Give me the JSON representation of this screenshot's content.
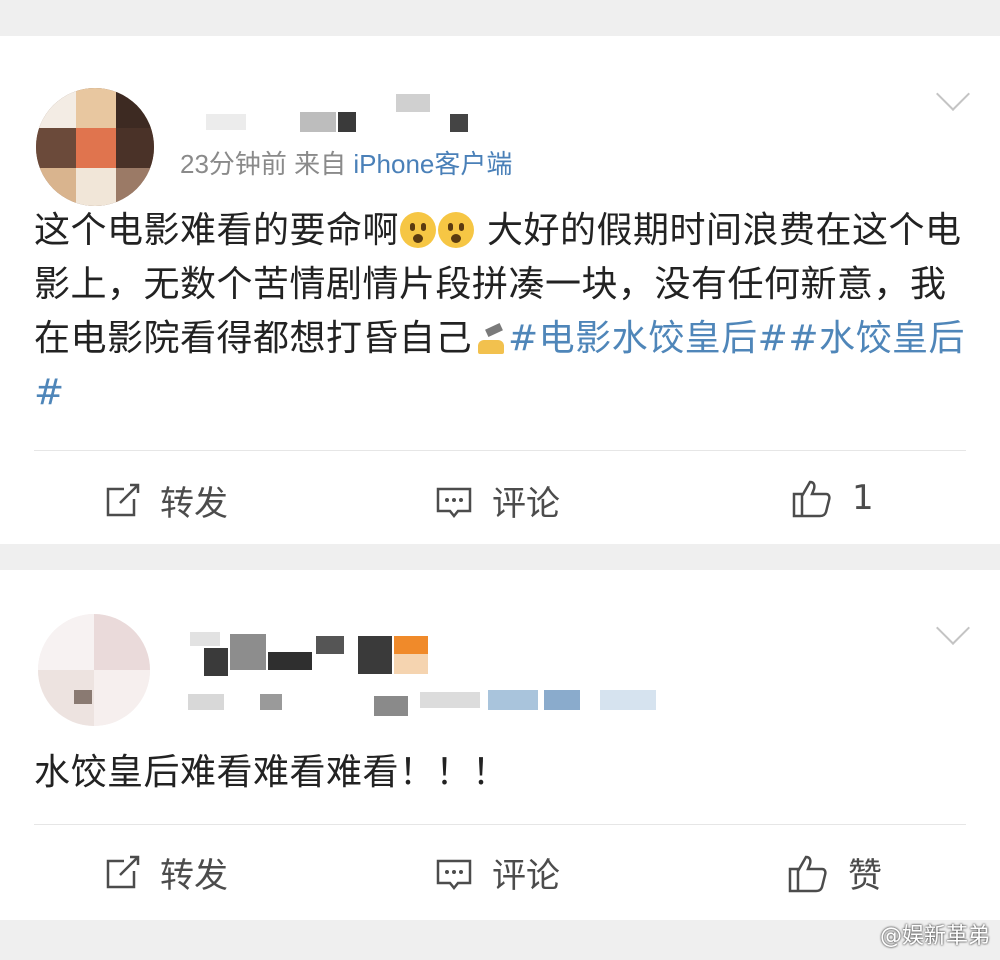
{
  "posts": [
    {
      "meta_time": "23分钟前",
      "meta_from": "来自",
      "meta_source": "iPhone客户端",
      "text_parts": [
        {
          "t": "这个电影难看的要命啊",
          "tag": false
        },
        {
          "emoji": "shocked-face"
        },
        {
          "emoji": "shocked-face"
        },
        {
          "t": " 大好的假期时间浪费在这个电影上，无数个苦情剧情片段拼凑一块，没有任何新意，我在电影院看得都想打昏自己",
          "tag": false
        },
        {
          "emoji": "hammer-hit"
        },
        {
          "t": "#电影水饺皇后##水饺皇后#",
          "tag": true
        }
      ],
      "actions": {
        "repost": "转发",
        "comment": "评论",
        "like": "1"
      }
    },
    {
      "text": "水饺皇后难看难看难看！！！",
      "actions": {
        "repost": "转发",
        "comment": "评论",
        "like": "赞"
      }
    }
  ],
  "watermark": "@娱新革弟",
  "colors": {
    "link": "#4f86b9",
    "background": "#efefef",
    "text": "#222222"
  }
}
